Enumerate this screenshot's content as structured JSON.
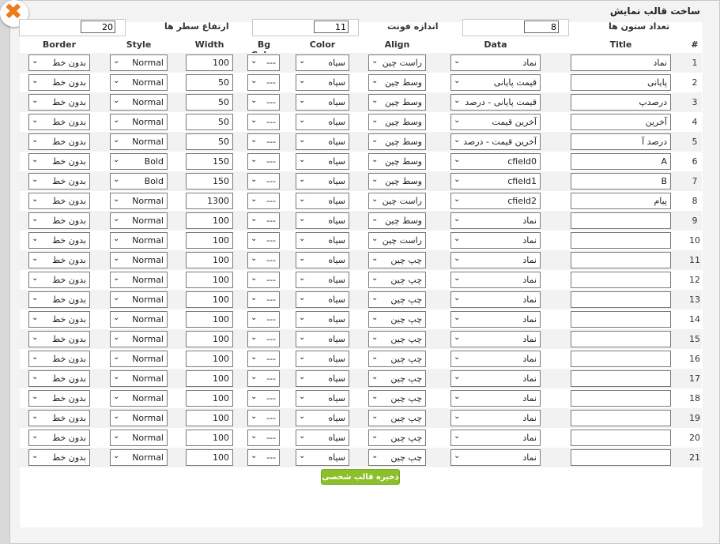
{
  "dialog": {
    "title": "ساخت قالب نمایش",
    "close_icon": "close-icon",
    "save_label": "ذخیره قالب شخصی"
  },
  "settings": {
    "columns_label": "تعداد ستون ها",
    "columns_value": "8",
    "font_size_label": "اندازه فونت",
    "font_size_value": "11",
    "row_height_label": "ارتفاع سطر ها",
    "row_height_value": "20"
  },
  "headers": {
    "num": "#",
    "title": "Title",
    "data": "Data",
    "align": "Align",
    "color": "Color",
    "bgcolor": "Bg Color",
    "width": "Width",
    "style": "Style",
    "border": "Border"
  },
  "rows": [
    {
      "num": "1",
      "title": "نماد",
      "data": "نماد",
      "align": "راست چین",
      "color": "سیاه",
      "bg": "---",
      "width": "100",
      "style": "Normal",
      "border": "بدون خط"
    },
    {
      "num": "2",
      "title": "پایانی",
      "data": "قیمت پایانی",
      "align": "وسط چین",
      "color": "سیاه",
      "bg": "---",
      "width": "50",
      "style": "Normal",
      "border": "بدون خط"
    },
    {
      "num": "3",
      "title": "درصدپ",
      "data": "قیمت پایانی - درصد",
      "align": "وسط چین",
      "color": "سیاه",
      "bg": "---",
      "width": "50",
      "style": "Normal",
      "border": "بدون خط"
    },
    {
      "num": "4",
      "title": "آخرین",
      "data": "آخرین قیمت",
      "align": "وسط چین",
      "color": "سیاه",
      "bg": "---",
      "width": "50",
      "style": "Normal",
      "border": "بدون خط"
    },
    {
      "num": "5",
      "title": "درصد آ",
      "data": "آخرین قیمت - درصد",
      "align": "وسط چین",
      "color": "سیاه",
      "bg": "---",
      "width": "50",
      "style": "Normal",
      "border": "بدون خط"
    },
    {
      "num": "6",
      "title": "A",
      "data": "cfield0",
      "align": "وسط چین",
      "color": "سیاه",
      "bg": "---",
      "width": "150",
      "style": "Bold",
      "border": "بدون خط"
    },
    {
      "num": "7",
      "title": "B",
      "data": "cfield1",
      "align": "وسط چین",
      "color": "سیاه",
      "bg": "---",
      "width": "150",
      "style": "Bold",
      "border": "بدون خط"
    },
    {
      "num": "8",
      "title": "پیام",
      "data": "cfield2",
      "align": "راست چین",
      "color": "سیاه",
      "bg": "---",
      "width": "1300",
      "style": "Normal",
      "border": "بدون خط"
    },
    {
      "num": "9",
      "title": "",
      "data": "نماد",
      "align": "وسط چین",
      "color": "سیاه",
      "bg": "---",
      "width": "100",
      "style": "Normal",
      "border": "بدون خط"
    },
    {
      "num": "10",
      "title": "",
      "data": "نماد",
      "align": "راست چین",
      "color": "سیاه",
      "bg": "---",
      "width": "100",
      "style": "Normal",
      "border": "بدون خط"
    },
    {
      "num": "11",
      "title": "",
      "data": "نماد",
      "align": "چپ چین",
      "color": "سیاه",
      "bg": "---",
      "width": "100",
      "style": "Normal",
      "border": "بدون خط"
    },
    {
      "num": "12",
      "title": "",
      "data": "نماد",
      "align": "چپ چین",
      "color": "سیاه",
      "bg": "---",
      "width": "100",
      "style": "Normal",
      "border": "بدون خط"
    },
    {
      "num": "13",
      "title": "",
      "data": "نماد",
      "align": "چپ چین",
      "color": "سیاه",
      "bg": "---",
      "width": "100",
      "style": "Normal",
      "border": "بدون خط"
    },
    {
      "num": "14",
      "title": "",
      "data": "نماد",
      "align": "چپ چین",
      "color": "سیاه",
      "bg": "---",
      "width": "100",
      "style": "Normal",
      "border": "بدون خط"
    },
    {
      "num": "15",
      "title": "",
      "data": "نماد",
      "align": "چپ چین",
      "color": "سیاه",
      "bg": "---",
      "width": "100",
      "style": "Normal",
      "border": "بدون خط"
    },
    {
      "num": "16",
      "title": "",
      "data": "نماد",
      "align": "چپ چین",
      "color": "سیاه",
      "bg": "---",
      "width": "100",
      "style": "Normal",
      "border": "بدون خط"
    },
    {
      "num": "17",
      "title": "",
      "data": "نماد",
      "align": "چپ چین",
      "color": "سیاه",
      "bg": "---",
      "width": "100",
      "style": "Normal",
      "border": "بدون خط"
    },
    {
      "num": "18",
      "title": "",
      "data": "نماد",
      "align": "چپ چین",
      "color": "سیاه",
      "bg": "---",
      "width": "100",
      "style": "Normal",
      "border": "بدون خط"
    },
    {
      "num": "19",
      "title": "",
      "data": "نماد",
      "align": "چپ چین",
      "color": "سیاه",
      "bg": "---",
      "width": "100",
      "style": "Normal",
      "border": "بدون خط"
    },
    {
      "num": "20",
      "title": "",
      "data": "نماد",
      "align": "چپ چین",
      "color": "سیاه",
      "bg": "---",
      "width": "100",
      "style": "Normal",
      "border": "بدون خط"
    },
    {
      "num": "21",
      "title": "",
      "data": "نماد",
      "align": "چپ چین",
      "color": "سیاه",
      "bg": "---",
      "width": "100",
      "style": "Normal",
      "border": "بدون خط"
    }
  ],
  "colors": {
    "accent": "#8bc02a",
    "close": "#f07b19",
    "row_alt": "#f2f2f2"
  }
}
